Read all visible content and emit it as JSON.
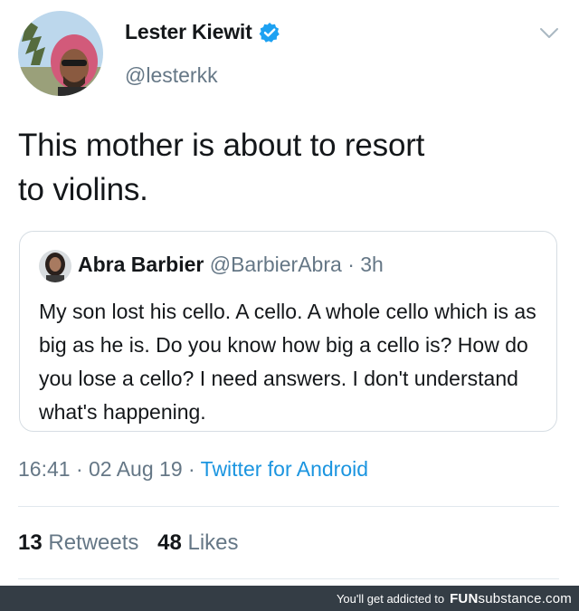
{
  "tweet": {
    "author_name": "Lester Kiewit",
    "author_handle": "@lesterkk",
    "text_line1": "This mother is about to resort",
    "text_line2": "to violins.",
    "time": "16:41",
    "date": "02 Aug 19",
    "source": "Twitter for Android",
    "sep1": "·",
    "sep2": "·"
  },
  "quoted": {
    "author_name": "Abra Barbier",
    "author_handle": "@BarbierAbra",
    "sep": "·",
    "age": "3h",
    "text": "My son lost his cello. A cello. A whole cello which is as big as he is. Do you know how big a cello is? How do you lose a cello? I need answers. I don't understand what's happening."
  },
  "stats": {
    "retweets_count": "13",
    "retweets_label": "Retweets",
    "likes_count": "48",
    "likes_label": "Likes"
  },
  "footer": {
    "text": "You'll get addicted to",
    "brand_a": "FUN",
    "brand_b": "substance",
    "brand_c": ".com"
  },
  "icons": {
    "verified": "verified-badge-icon",
    "menu": "chevron-down-icon"
  },
  "colors": {
    "verified": "#1da1f2",
    "link": "#1b95e0",
    "muted": "#657786",
    "footer_bg": "#343d45"
  }
}
